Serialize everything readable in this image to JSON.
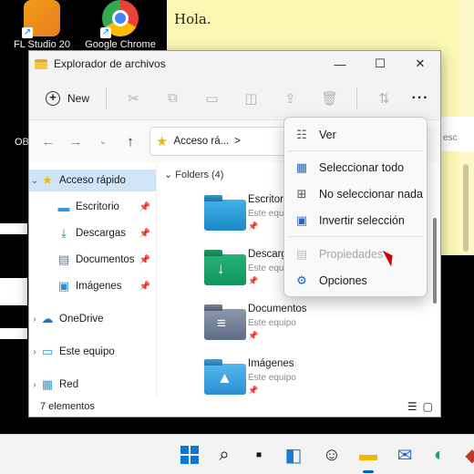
{
  "desktop": {
    "icons": [
      {
        "label": "FL Studio 20",
        "icon": "fl-studio-icon"
      },
      {
        "label": "Google Chrome",
        "icon": "chrome-icon"
      }
    ],
    "partial_labels": {
      "obs": "OB",
      "edge_right": "esc"
    }
  },
  "sticky_note": {
    "text": "Hola."
  },
  "window": {
    "title": "Explorador de archivos",
    "controls": {
      "minimize": "—",
      "maximize": "☐",
      "close": "✕"
    },
    "toolbar": {
      "new_label": "New",
      "more": "···"
    },
    "address": {
      "path": "Acceso rá...",
      "chevron": ">"
    },
    "nav_pane": {
      "items": [
        {
          "label": "Acceso rápido",
          "icon": "star-icon",
          "expanded": true,
          "selected": true
        },
        {
          "label": "Escritorio",
          "icon": "desktop-folder-icon",
          "pinned": true
        },
        {
          "label": "Descargas",
          "icon": "downloads-icon",
          "pinned": true
        },
        {
          "label": "Documentos",
          "icon": "documents-icon",
          "pinned": true
        },
        {
          "label": "Imágenes",
          "icon": "pictures-icon",
          "pinned": true
        },
        {
          "label": "OneDrive",
          "icon": "onedrive-icon"
        },
        {
          "label": "Este equipo",
          "icon": "pc-icon"
        },
        {
          "label": "Red",
          "icon": "network-icon"
        }
      ]
    },
    "content": {
      "group_header": "Folders (4)",
      "folders": [
        {
          "name": "Escritorio",
          "location": "Este equipo"
        },
        {
          "name": "Descargas",
          "location": "Este equipo"
        },
        {
          "name": "Documentos",
          "location": "Este equipo"
        },
        {
          "name": "Imágenes",
          "location": "Este equipo"
        }
      ]
    },
    "status": {
      "count": "7 elementos"
    }
  },
  "menu": {
    "items": [
      {
        "label": "Ver",
        "icon": "view-icon",
        "enabled": true
      },
      {
        "label": "Seleccionar todo",
        "icon": "select-all-icon",
        "enabled": true
      },
      {
        "label": "No seleccionar nada",
        "icon": "select-none-icon",
        "enabled": true
      },
      {
        "label": "Invertir selección",
        "icon": "invert-selection-icon",
        "enabled": true
      },
      {
        "label": "Propiedades",
        "icon": "properties-icon",
        "enabled": false
      },
      {
        "label": "Opciones",
        "icon": "options-icon",
        "enabled": true
      }
    ]
  },
  "taskbar": {
    "apps": [
      "start",
      "search",
      "task-view",
      "widgets",
      "game",
      "file-explorer",
      "mail",
      "edge",
      "app"
    ]
  },
  "colors": {
    "accent": "#0067c0",
    "selection": "#cfe4f7",
    "sticky": "#fbf7b5"
  }
}
